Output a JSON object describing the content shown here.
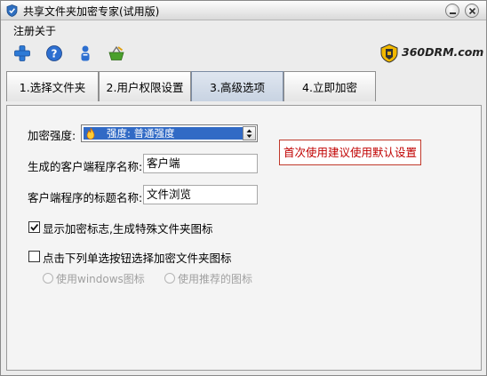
{
  "window": {
    "title": "共享文件夹加密专家(试用版)"
  },
  "menu": {
    "items": [
      "注册",
      "关于"
    ]
  },
  "toolbar": {
    "icons": [
      "add-icon",
      "help-icon",
      "user-icon",
      "basket-icon"
    ],
    "brand": "360DRM.com"
  },
  "tabs": [
    {
      "label": "1.选择文件夹",
      "active": false
    },
    {
      "label": "2.用户权限设置",
      "active": false
    },
    {
      "label": "3.高级选项",
      "active": true
    },
    {
      "label": "4.立即加密",
      "active": false
    }
  ],
  "advanced": {
    "strength_label": "加密强度:",
    "strength_value": "强度: 普通强度",
    "client_name_label": "生成的客户端程序名称:",
    "client_name_value": "客户端",
    "client_title_label": "客户端程序的标题名称:",
    "client_title_value": "文件浏览",
    "hint": "首次使用建议使用默认设置",
    "show_mark_label": "显示加密标志,生成特殊文件夹图标",
    "show_mark_checked": true,
    "choose_icon_label": "点击下列单选按钮选择加密文件夹图标",
    "choose_icon_checked": false,
    "radio_windows": "使用windows图标",
    "radio_recommended": "使用推荐的图标"
  },
  "colors": {
    "selection": "#316ac5",
    "hint_border": "#c0392b",
    "hint_text": "#c00000",
    "active_tab": "#c8d3e2"
  }
}
